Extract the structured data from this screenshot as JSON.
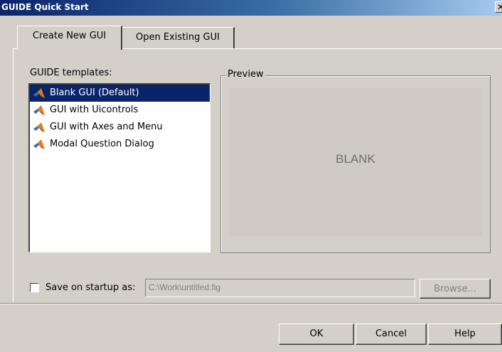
{
  "window": {
    "title": "GUIDE Quick Start",
    "close_glyph": "✕"
  },
  "tabs": [
    {
      "label": "Create New GUI",
      "active": true
    },
    {
      "label": "Open Existing GUI",
      "active": false
    }
  ],
  "templates": {
    "label": "GUIDE templates:",
    "items": [
      {
        "label": "Blank GUI (Default)",
        "icon": "matlab-logo-icon",
        "selected": true
      },
      {
        "label": "GUI with Uicontrols",
        "icon": "matlab-logo-icon",
        "selected": false
      },
      {
        "label": "GUI with Axes and Menu",
        "icon": "matlab-logo-icon",
        "selected": false
      },
      {
        "label": "Modal Question Dialog",
        "icon": "matlab-logo-icon",
        "selected": false
      }
    ]
  },
  "preview": {
    "legend": "Preview",
    "content": "BLANK"
  },
  "save_on_startup": {
    "label": "Save on startup as:",
    "checked": false,
    "path_value": "C:\\Work\\untitled.fig",
    "browse_label": "Browse..."
  },
  "buttons": {
    "ok": "OK",
    "cancel": "Cancel",
    "help": "Help"
  },
  "colors": {
    "titlebar": "#0a246a",
    "selection": "#0a246a",
    "face": "#d4d0c8"
  }
}
